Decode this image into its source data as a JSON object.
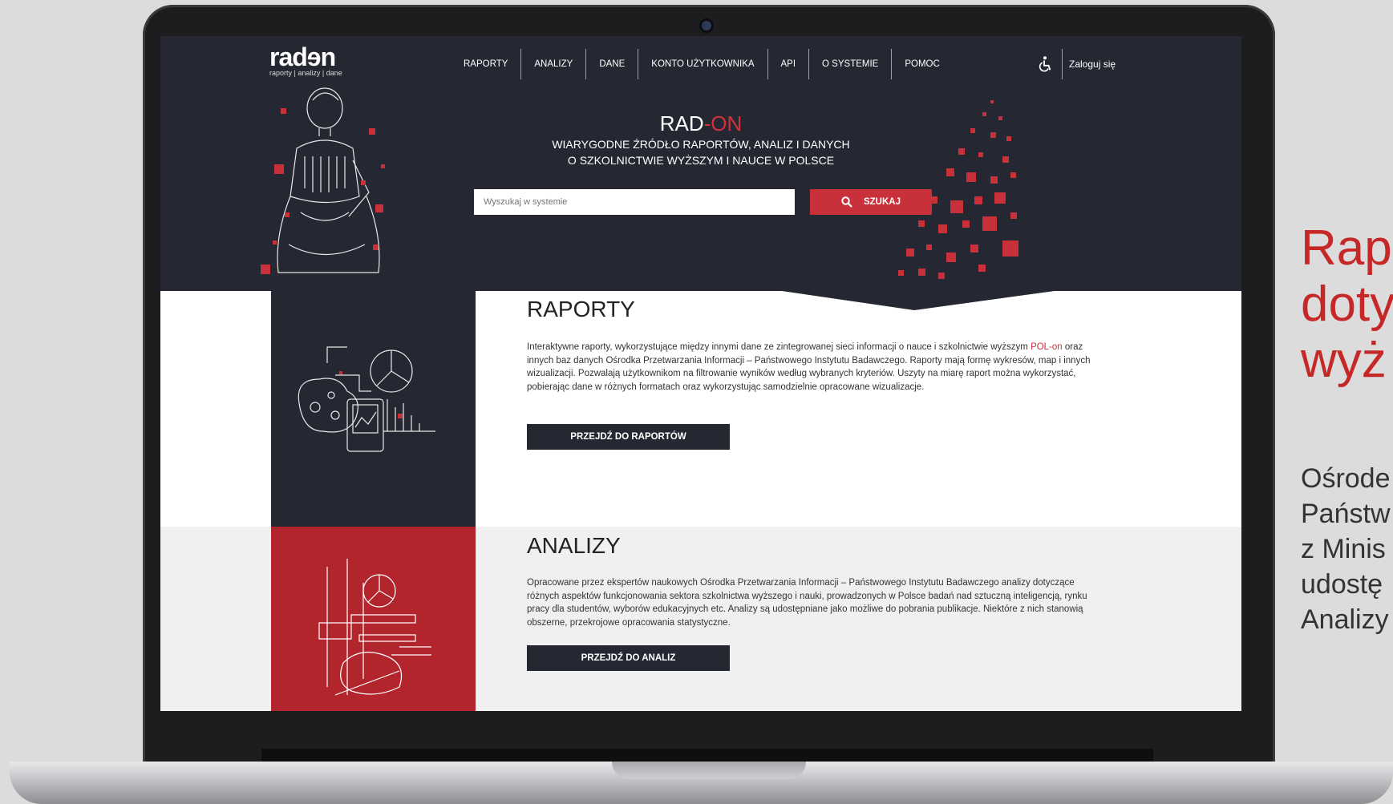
{
  "logo": {
    "word_part1": "rad",
    "word_glyph": "ɘ",
    "word_part2": "n",
    "sub": "raporty | analizy | dane"
  },
  "nav": {
    "items": [
      "RAPORTY",
      "ANALIZY",
      "DANE",
      "KONTO UŻYTKOWNIKA",
      "API",
      "O SYSTEMIE",
      "POMOC"
    ],
    "login_label": "Zaloguj się",
    "accessibility_icon": "accessibility-icon"
  },
  "hero": {
    "title_part1": "RAD",
    "title_part2": "-ON",
    "subtitle_line1": "WIARYGODNE ŹRÓDŁO RAPORTÓW, ANALIZ I DANYCH",
    "subtitle_line2": "O SZKOLNICTWIE WYŻSZYM I NAUCE W POLSCE"
  },
  "search": {
    "placeholder": "Wyszukaj w systemie",
    "button_label": "SZUKAJ",
    "icon": "search-icon"
  },
  "reports": {
    "title": "RAPORTY",
    "text_before_link": "Interaktywne raporty, wykorzystujące między innymi dane ze zintegrowanej sieci informacji o nauce i szkolnictwie wyższym ",
    "link": "POL-on",
    "text_after_link": " oraz innych baz danych Ośrodka Przetwarzania Informacji – Państwowego Instytutu Badawczego. Raporty mają formę wykresów, map i innych wizualizacji. Pozwalają użytkownikom na filtrowanie wyników według wybranych kryteriów. Uszyty na miarę raport można wykorzystać, pobierając dane w różnych formatach oraz wykorzystując samodzielnie opracowane wizualizacje.",
    "button": "PRZEJDŹ DO RAPORTÓW"
  },
  "analyses": {
    "title": "ANALIZY",
    "text": "Opracowane przez ekspertów naukowych Ośrodka Przetwarzania Informacji – Państwowego Instytutu Badawczego analizy dotyczące różnych aspektów funkcjonowania sektora szkolnictwa wyższego i nauki, prowadzonych w Polsce badań nad sztuczną inteligencją, rynku pracy dla studentów, wyborów edukacyjnych etc. Analizy są udostępniane jako możliwe do pobrania publikacje. Niektóre z nich stanowią obszerne, przekrojowe opracowania statystyczne.",
    "button": "PRZEJDŹ DO ANALIZ"
  },
  "side": {
    "title_lines": [
      "Rap",
      "doty",
      "wyż"
    ],
    "text_lines": [
      "Ośrode",
      "Państw",
      "z Minis",
      "udostę",
      "Analizy"
    ]
  },
  "colors": {
    "accent": "#c8303a",
    "dark": "#252832",
    "red_panel": "#b3252d"
  }
}
